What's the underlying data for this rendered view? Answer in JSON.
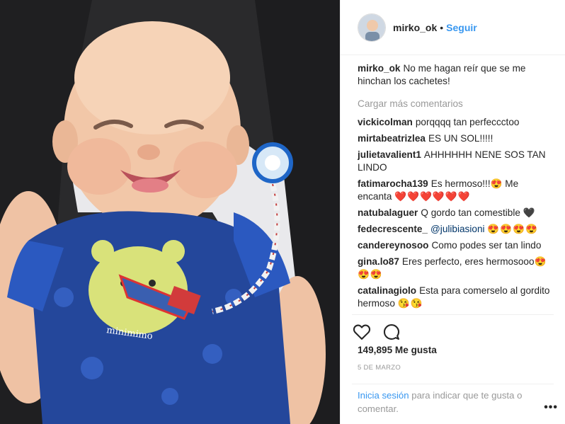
{
  "header": {
    "username": "mirko_ok",
    "separator": "•",
    "follow_label": "Seguir"
  },
  "caption": {
    "username": "mirko_ok",
    "text": "No me hagan reír que se me hinchan los cachetes!"
  },
  "load_more_label": "Cargar más comentarios",
  "comments": [
    {
      "username": "vickicolman",
      "text": "porqqqq tan perfeccctoo",
      "emoji": ""
    },
    {
      "username": "mirtabeatrizlea",
      "text": "ES UN SOL!!!!!",
      "emoji": ""
    },
    {
      "username": "julietavalient1",
      "text": "AHHHHHH NENE SOS TAN LINDO",
      "emoji": ""
    },
    {
      "username": "fatimarocha139",
      "text": "Es hermoso!!!😍 Me encanta",
      "emoji": "❤️❤️❤️❤️❤️❤️"
    },
    {
      "username": "natubalaguer",
      "text": "Q gordo tan comestible",
      "emoji": "🖤"
    },
    {
      "username": "fedecrescente_",
      "text": "",
      "mention": "@julibiasioni",
      "emoji": "😍😍😍😍"
    },
    {
      "username": "candereynosoo",
      "text": "Como podes ser tan lindo",
      "emoji": ""
    },
    {
      "username": "gina.lo87",
      "text": "Eres perfecto, eres hermosooo😍",
      "emoji": "😍😍"
    },
    {
      "username": "catalinagiolo",
      "text": "Esta para comerselo al gordito hermoso",
      "emoji": "😘😘"
    }
  ],
  "likes_text": "149,895 Me gusta",
  "date_text": "5 DE MARZO",
  "login": {
    "link_label": "Inicia sesión",
    "rest_text": "para indicar que te gusta o comentar."
  },
  "more_label": "•••",
  "icons": {
    "like": "heart-outline-icon",
    "comment": "comment-bubble-icon",
    "more": "more-options-icon"
  },
  "colors": {
    "link_blue": "#3897f0",
    "text": "#262626",
    "muted": "#999999",
    "divider": "#efefef"
  }
}
